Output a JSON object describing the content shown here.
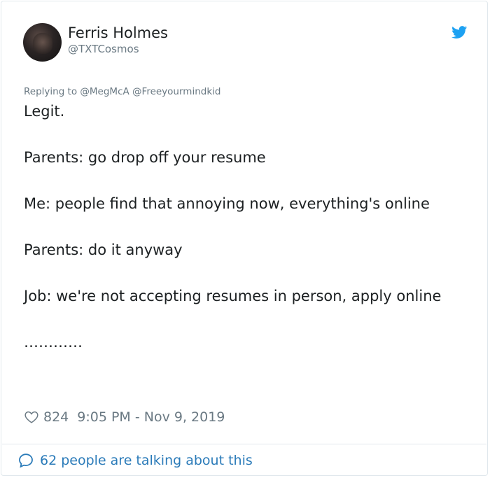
{
  "tweet": {
    "author_name": "Ferris Holmes",
    "author_handle": "@TXTCosmos",
    "replying_to_label": "Replying to",
    "replying_to": [
      "@MegMcA",
      "@Freeyourmindkid"
    ],
    "paragraphs": [
      "Legit.",
      "Parents: go drop off your resume",
      "Me: people find that annoying now, everything's online",
      "Parents: do it anyway",
      "Job: we're not accepting resumes in person, apply online",
      "…………"
    ],
    "likes": "824",
    "timestamp": "9:05 PM - Nov 9, 2019"
  },
  "footer": {
    "talking_text": "62 people are talking about this"
  },
  "icons": {
    "bird": "twitter-bird-icon",
    "heart": "heart-icon",
    "bubble": "speech-bubble-icon"
  },
  "colors": {
    "brand_blue": "#1da1f2",
    "link_blue": "#2b7bb9",
    "text": "#1c2022",
    "muted": "#697882",
    "border": "#e1e8ed"
  }
}
